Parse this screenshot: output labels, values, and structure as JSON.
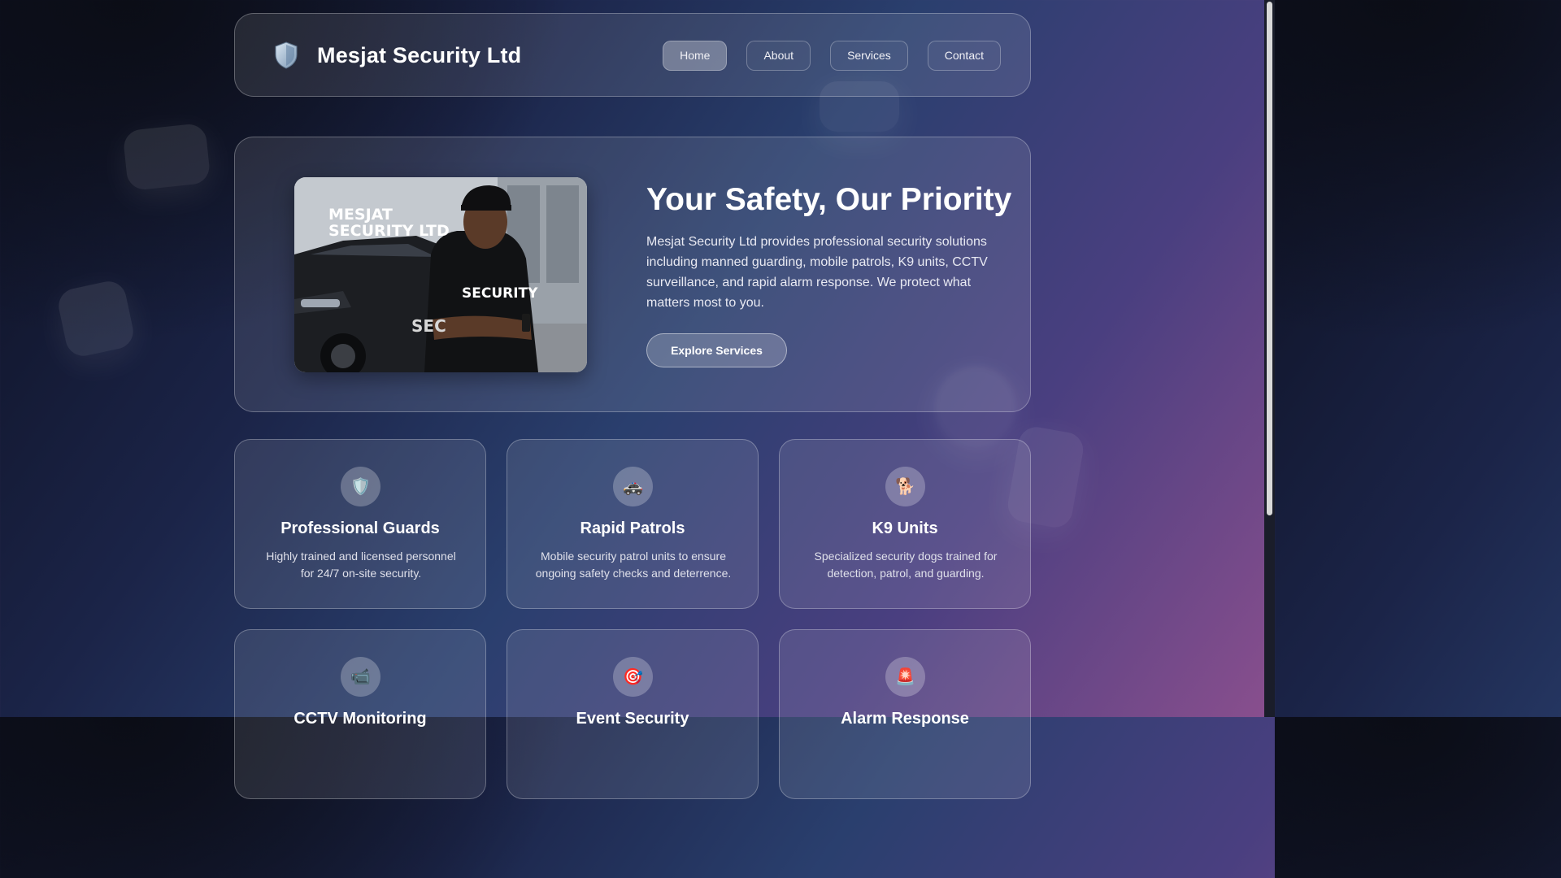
{
  "header": {
    "brand": "Mesjat Security Ltd",
    "nav": [
      {
        "label": "Home",
        "active": true
      },
      {
        "label": "About"
      },
      {
        "label": "Services"
      },
      {
        "label": "Contact"
      }
    ]
  },
  "hero": {
    "image_text_line1": "MESJAT",
    "image_text_line2": "SECURITY LTD",
    "image_shirt_text": "SECURITY",
    "image_car_text": "SEC",
    "title": "Your Safety, Our Priority",
    "description": "Mesjat Security Ltd provides professional security solutions including manned guarding, mobile patrols, K9 units, CCTV surveillance, and rapid alarm response. We protect what matters most to you.",
    "button": "Explore Services"
  },
  "services": [
    {
      "icon": "🛡️",
      "title": "Professional Guards",
      "desc": "Highly trained and licensed personnel for 24/7 on-site security."
    },
    {
      "icon": "🚓",
      "title": "Rapid Patrols",
      "desc": "Mobile security patrol units to ensure ongoing safety checks and deterrence."
    },
    {
      "icon": "🐕",
      "title": "K9 Units",
      "desc": "Specialized security dogs trained for detection, patrol, and guarding."
    },
    {
      "icon": "📹",
      "title": "CCTV Monitoring",
      "desc": ""
    },
    {
      "icon": "🎯",
      "title": "Event Security",
      "desc": ""
    },
    {
      "icon": "🚨",
      "title": "Alarm Response",
      "desc": ""
    }
  ]
}
